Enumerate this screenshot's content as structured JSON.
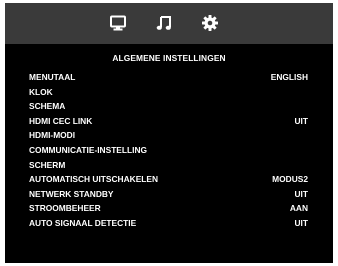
{
  "tabs": [
    {
      "icon": "monitor-icon",
      "selected": false
    },
    {
      "icon": "music-note-icon",
      "selected": false
    },
    {
      "icon": "gear-icon",
      "selected": true
    }
  ],
  "panel": {
    "title": "ALGEMENE INSTELLINGEN",
    "rows": [
      {
        "label": "MENUTAAL",
        "value": "ENGLISH"
      },
      {
        "label": "KLOK",
        "value": ""
      },
      {
        "label": "SCHEMA",
        "value": ""
      },
      {
        "label": "HDMI CEC LINK",
        "value": "UIT"
      },
      {
        "label": "HDMI-MODI",
        "value": ""
      },
      {
        "label": "COMMUNICATIE-INSTELLING",
        "value": ""
      },
      {
        "label": "SCHERM",
        "value": ""
      },
      {
        "label": "AUTOMATISCH UITSCHAKELEN",
        "value": "MODUS2"
      },
      {
        "label": "NETWERK STANDBY",
        "value": "UIT"
      },
      {
        "label": "STROOMBEHEER",
        "value": "AAN"
      },
      {
        "label": "AUTO SIGNAAL DETECTIE",
        "value": "UIT"
      }
    ]
  },
  "colors": {
    "topbar": "#3a3a3a",
    "panel": "#000000",
    "text": "#ffffff",
    "frame": "#cfcfcf"
  }
}
